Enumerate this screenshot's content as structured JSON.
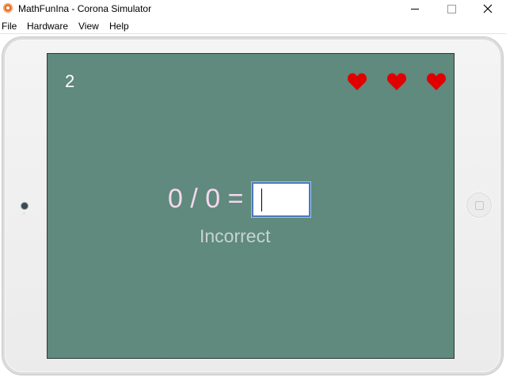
{
  "window": {
    "title": "MathFunIna - Corona Simulator"
  },
  "menu": {
    "items": [
      {
        "label": "File"
      },
      {
        "label": "Hardware"
      },
      {
        "label": "View"
      },
      {
        "label": "Help"
      }
    ]
  },
  "game": {
    "level": "2",
    "lives": 3,
    "heart_color": "#e00000",
    "question": "0 / 0 =",
    "answer_value": "",
    "feedback": "Incorrect",
    "background_color": "#5f8a7d"
  },
  "icons": {
    "app": "corona-simulator-icon",
    "life": "heart-icon",
    "minimize": "minimize-icon",
    "maximize": "maximize-icon",
    "close": "close-icon"
  }
}
